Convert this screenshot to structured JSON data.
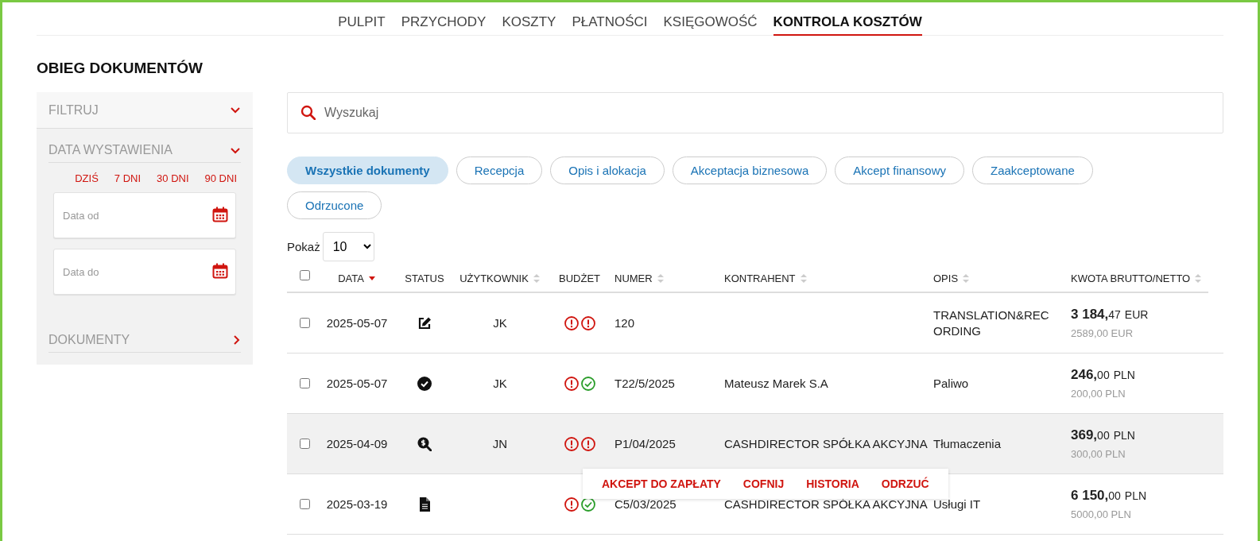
{
  "nav": [
    {
      "label": "PULPIT",
      "selected": false
    },
    {
      "label": "PRZYCHODY",
      "selected": false
    },
    {
      "label": "KOSZTY",
      "selected": false
    },
    {
      "label": "PŁATNOŚCI",
      "selected": false
    },
    {
      "label": "KSIĘGOWOŚĆ",
      "selected": false
    },
    {
      "label": "KONTROLA KOSZTÓW",
      "selected": true
    }
  ],
  "page_title": "OBIEG DOKUMENTÓW",
  "sidebar": {
    "sections": [
      {
        "kind": "header",
        "title": "FILTRUJ",
        "expanded": true
      },
      {
        "kind": "dates",
        "title": "DATA WYSTAWIENIA",
        "expanded": true,
        "quick_ranges": [
          "DZIŚ",
          "7 DNI",
          "30 DNI",
          "90 DNI"
        ],
        "fields": [
          {
            "placeholder": "Data od"
          },
          {
            "placeholder": "Data do"
          }
        ]
      },
      {
        "kind": "header",
        "title": "DOKUMENTY",
        "expanded": false
      }
    ]
  },
  "search": {
    "placeholder": "Wyszukaj"
  },
  "filters": [
    {
      "label": "Wszystkie dokumenty",
      "selected": true
    },
    {
      "label": "Recepcja",
      "selected": false
    },
    {
      "label": "Opis i alokacja",
      "selected": false
    },
    {
      "label": "Akceptacja biznesowa",
      "selected": false
    },
    {
      "label": "Akcept finansowy",
      "selected": false
    },
    {
      "label": "Zaakceptowane",
      "selected": false
    },
    {
      "label": "Odrzucone",
      "selected": false
    }
  ],
  "page_size": {
    "label": "Pokaż",
    "value": "10"
  },
  "table": {
    "columns": [
      {
        "label": "DATA",
        "kind": "descending"
      },
      {
        "label": "STATUS",
        "kind": "plain"
      },
      {
        "label": "UŻYTKOWNIK",
        "kind": "sortable"
      },
      {
        "label": "BUDŻET",
        "kind": "plain"
      },
      {
        "label": "NUMER",
        "kind": "sortable"
      },
      {
        "label": "KONTRAHENT",
        "kind": "sortable"
      },
      {
        "label": "OPIS",
        "kind": "sortable"
      },
      {
        "label": "KWOTA BRUTTO/NETTO",
        "kind": "sortable"
      }
    ],
    "select_all": {
      "checked": false
    },
    "rows": [
      {
        "checked": false,
        "hovered": false,
        "date": "2025-05-07",
        "status": {
          "kind": "edit"
        },
        "user": "JK",
        "budget": [
          {
            "kind": "warning"
          },
          {
            "kind": "warning"
          }
        ],
        "number": "120",
        "description": "TRANSLATION&RECORDING",
        "gross_whole": "3 184,",
        "gross_fraction": "47",
        "currency": "EUR",
        "net": "2589,00 EUR"
      },
      {
        "checked": false,
        "hovered": false,
        "date": "2025-05-07",
        "status": {
          "kind": "approved"
        },
        "user": "JK",
        "budget": [
          {
            "kind": "warning"
          },
          {
            "kind": "ok"
          }
        ],
        "number": "T22/5/2025",
        "contractor": "Mateusz Marek S.A",
        "description": "Paliwo",
        "gross_whole": "246,",
        "gross_fraction": "00",
        "currency": "PLN",
        "net": "200,00 PLN"
      },
      {
        "checked": false,
        "hovered": true,
        "date": "2025-04-09",
        "status": {
          "kind": "review"
        },
        "user": "JN",
        "budget": [
          {
            "kind": "warning"
          },
          {
            "kind": "warning"
          }
        ],
        "number": "P1/04/2025",
        "contractor": "CASHDIRECTOR SPÓŁKA AKCYJNA",
        "description": "Tłumaczenia",
        "gross_whole": "369,",
        "gross_fraction": "00",
        "currency": "PLN",
        "net": "300,00 PLN",
        "actions": [
          "AKCEPT DO ZAPŁATY",
          "COFNIJ",
          "HISTORIA",
          "ODRZUĆ"
        ]
      },
      {
        "checked": false,
        "hovered": false,
        "date": "2025-03-19",
        "status": {
          "kind": "document"
        },
        "budget": [
          {
            "kind": "warning"
          },
          {
            "kind": "ok"
          }
        ],
        "number": "C5/03/2025",
        "contractor": "CASHDIRECTOR SPÓŁKA AKCYJNA",
        "description": "Usługi IT",
        "gross_whole": "6 150,",
        "gross_fraction": "00",
        "currency": "PLN",
        "net": "5000,00 PLN"
      }
    ]
  }
}
